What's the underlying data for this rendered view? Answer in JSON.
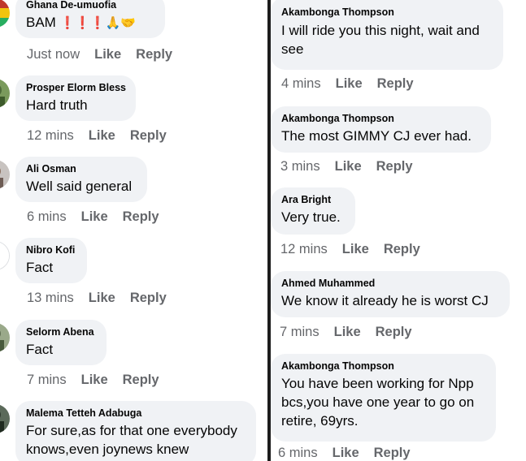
{
  "left_comments": [
    {
      "author": "Ghana De-umuofia",
      "text": "BAM",
      "emoji": "❗❗❗🙏🤝",
      "time": "Just now",
      "like": "Like",
      "reply": "Reply"
    },
    {
      "author": "Prosper Elorm Bless",
      "text": "Hard truth",
      "time": "12 mins",
      "like": "Like",
      "reply": "Reply"
    },
    {
      "author": "Ali Osman",
      "text": "Well said general",
      "time": "6 mins",
      "like": "Like",
      "reply": "Reply"
    },
    {
      "author": "Nibro Kofi",
      "text": "Fact",
      "time": "13 mins",
      "like": "Like",
      "reply": "Reply"
    },
    {
      "author": "Selorm Abena",
      "text": "Fact",
      "time": "7 mins",
      "like": "Like",
      "reply": "Reply"
    },
    {
      "author": "Malema Tetteh Adabuga",
      "text": "For sure,as for that one everybody knows,even joynews knew",
      "time": "",
      "like": "",
      "reply": ""
    }
  ],
  "right_comments": [
    {
      "author": "Akambonga Thompson",
      "text": "I will ride you this night, wait and see",
      "time": "4 mins",
      "like": "Like",
      "reply": "Reply"
    },
    {
      "author": "Akambonga Thompson",
      "text": "The most GIMMY CJ ever had.",
      "time": "3 mins",
      "like": "Like",
      "reply": "Reply"
    },
    {
      "author": "Ara Bright",
      "text": "Very true.",
      "time": "12 mins",
      "like": "Like",
      "reply": "Reply"
    },
    {
      "author": "Ahmed Muhammed",
      "text": "We know it already he is worst CJ",
      "time": "7 mins",
      "like": "Like",
      "reply": "Reply"
    },
    {
      "author": "Akambonga Thompson",
      "text": "You have been working for  Npp bcs,you have one year to go on retire, 69yrs.",
      "time": "6 mins",
      "like": "Like",
      "reply": "Reply"
    }
  ],
  "colors": {
    "bubble": "#f0f2f5",
    "meta_text": "#65676b",
    "text": "#050505",
    "divider": "#1c1c1c"
  }
}
